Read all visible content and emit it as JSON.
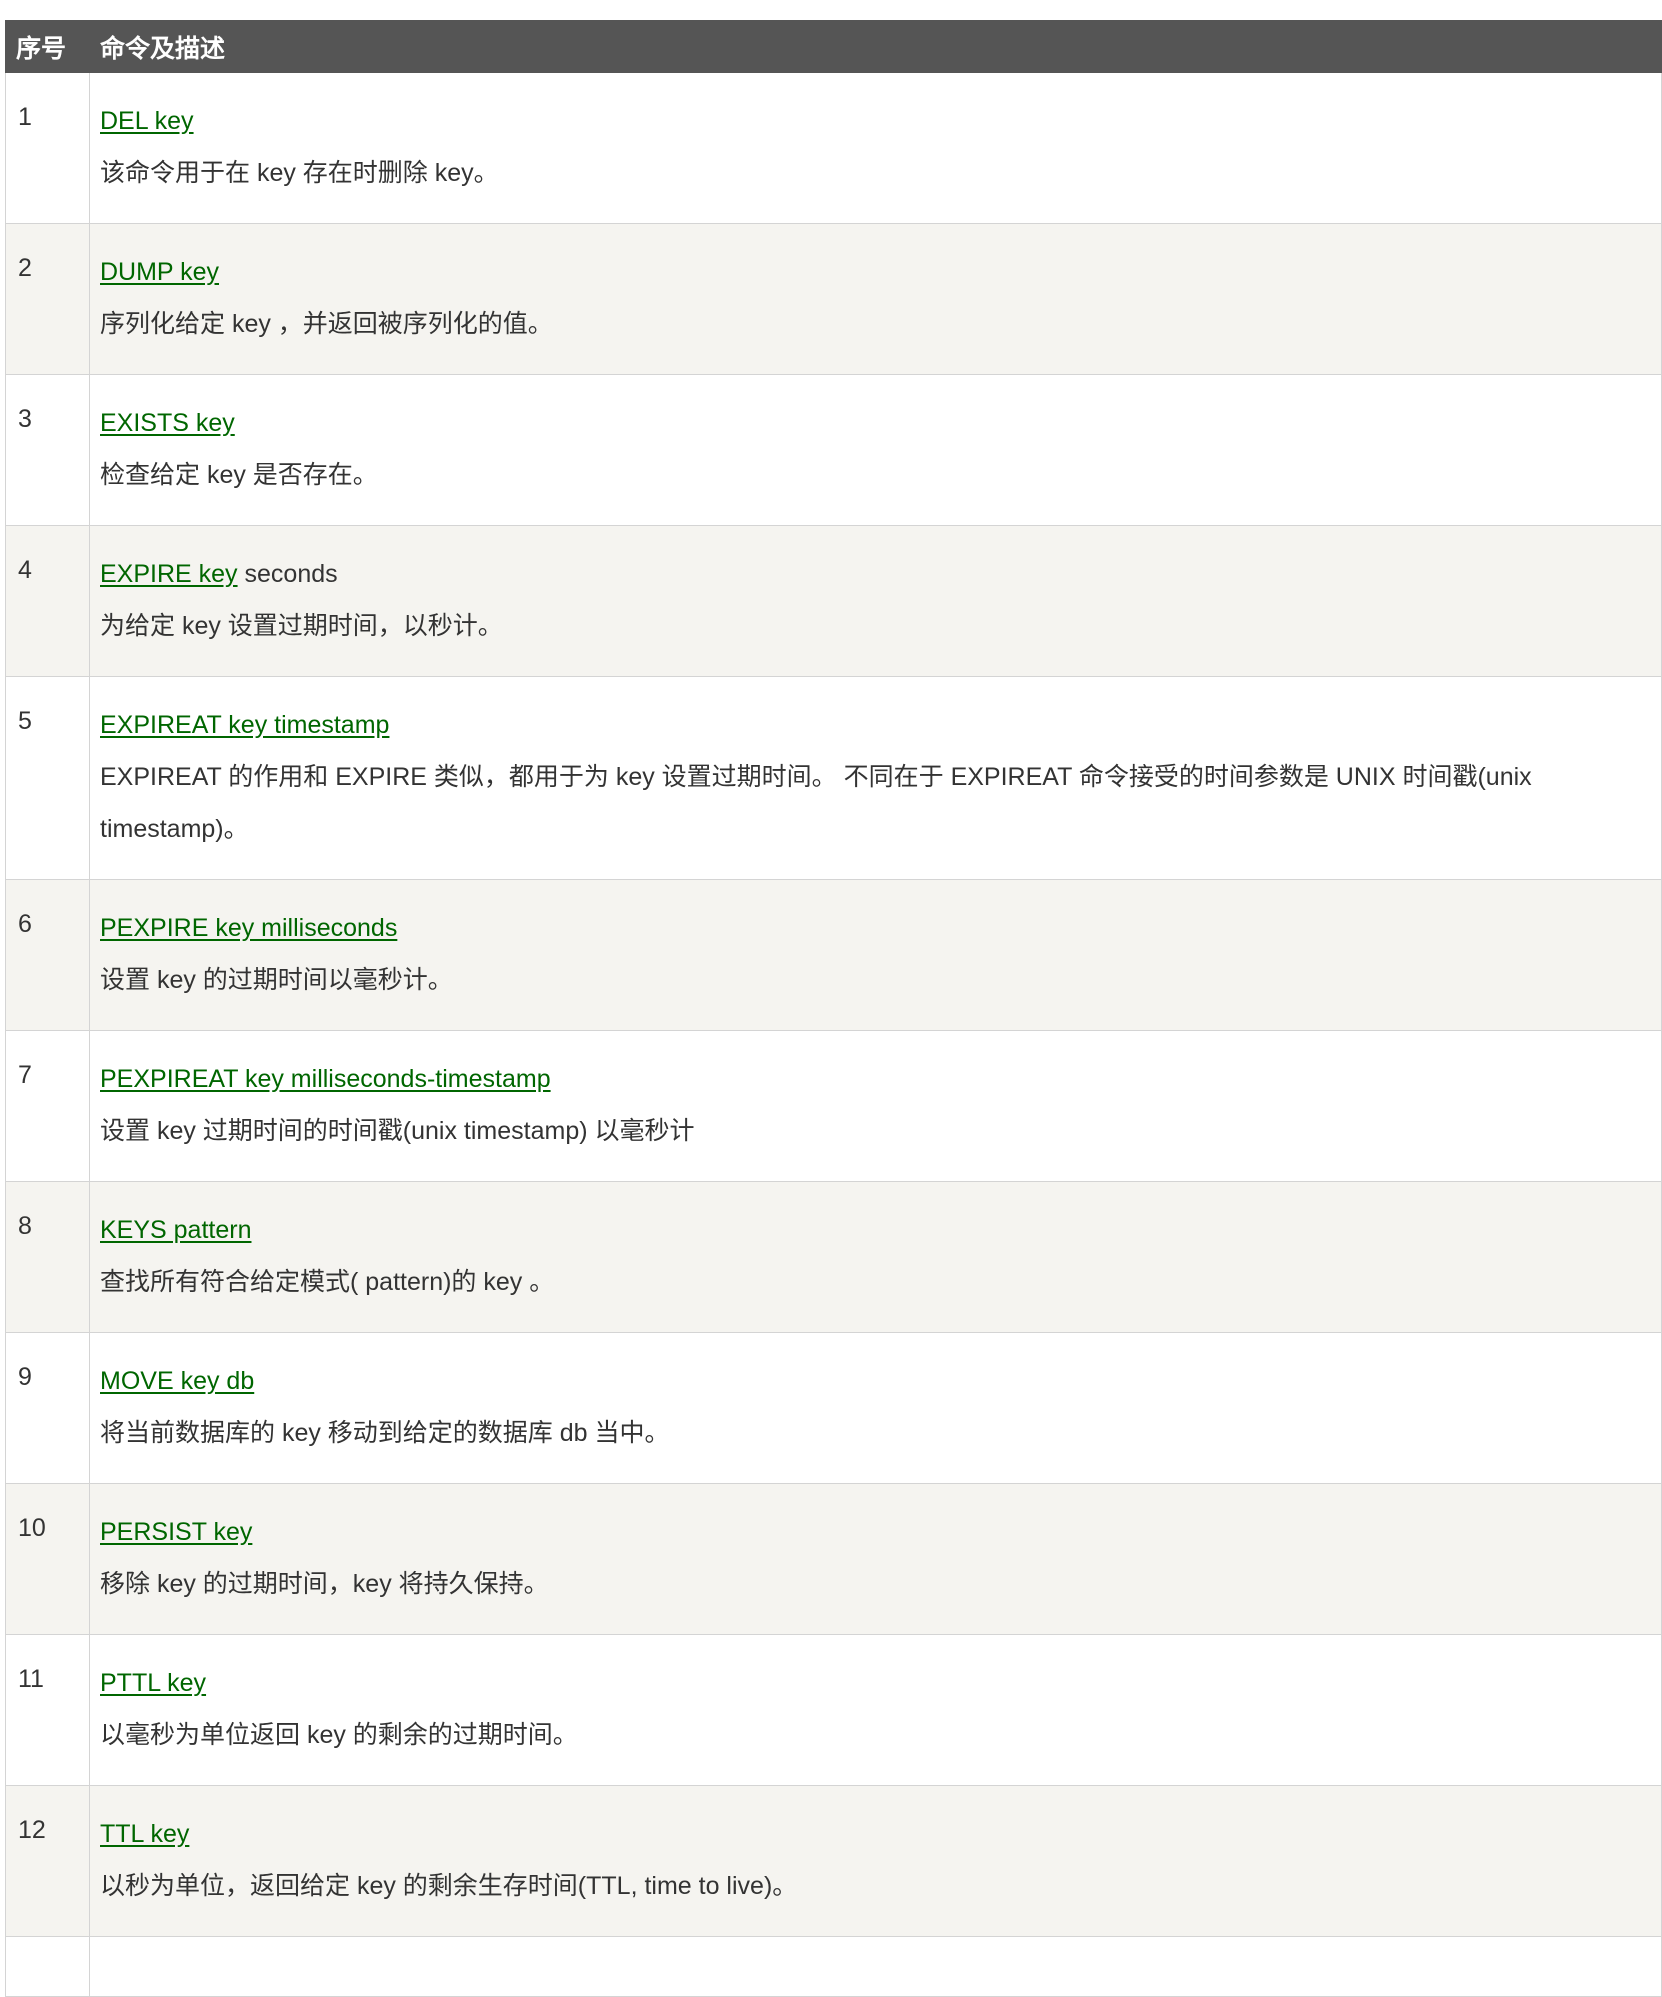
{
  "table": {
    "headers": {
      "num": "序号",
      "cmd": "命令及描述"
    },
    "rows": [
      {
        "num": "1",
        "link": "DEL key",
        "suffix": "",
        "desc": "该命令用于在 key 存在时删除 key。"
      },
      {
        "num": "2",
        "link": "DUMP key",
        "suffix": "",
        "desc": "序列化给定 key ，并返回被序列化的值。"
      },
      {
        "num": "3",
        "link": "EXISTS key",
        "suffix": "",
        "desc": "检查给定 key 是否存在。"
      },
      {
        "num": "4",
        "link": "EXPIRE key",
        "suffix": " seconds",
        "desc": "为给定 key 设置过期时间，以秒计。"
      },
      {
        "num": "5",
        "link": "EXPIREAT key timestamp",
        "suffix": "",
        "desc": "EXPIREAT 的作用和 EXPIRE 类似，都用于为 key 设置过期时间。 不同在于 EXPIREAT 命令接受的时间参数是 UNIX 时间戳(unix timestamp)。"
      },
      {
        "num": "6",
        "link": "PEXPIRE key milliseconds",
        "suffix": "",
        "desc": "设置 key 的过期时间以毫秒计。"
      },
      {
        "num": "7",
        "link": "PEXPIREAT key milliseconds-timestamp",
        "suffix": "",
        "desc": "设置 key 过期时间的时间戳(unix timestamp) 以毫秒计"
      },
      {
        "num": "8",
        "link": "KEYS pattern",
        "suffix": "",
        "desc": "查找所有符合给定模式( pattern)的 key 。"
      },
      {
        "num": "9",
        "link": "MOVE key db",
        "suffix": "",
        "desc": "将当前数据库的 key 移动到给定的数据库 db 当中。"
      },
      {
        "num": "10",
        "link": "PERSIST key",
        "suffix": "",
        "desc": "移除 key 的过期时间，key 将持久保持。"
      },
      {
        "num": "11",
        "link": "PTTL key",
        "suffix": "",
        "desc": "以毫秒为单位返回 key 的剩余的过期时间。"
      },
      {
        "num": "12",
        "link": "TTL key",
        "suffix": "",
        "desc": "以秒为单位，返回给定 key 的剩余生存时间(TTL, time to live)。"
      },
      {
        "num": "",
        "link": "",
        "suffix": "",
        "desc": ""
      }
    ]
  },
  "colors": {
    "header_bg": "#555555",
    "link": "#006600",
    "stripe": "#f5f4f0",
    "border": "#d4d4d4"
  }
}
